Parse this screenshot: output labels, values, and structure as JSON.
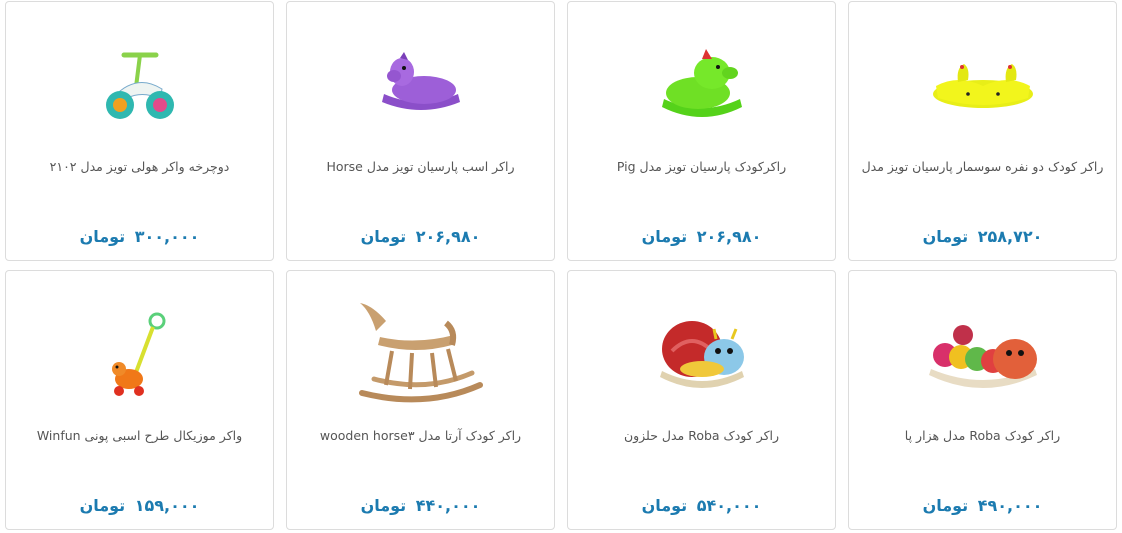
{
  "products": [
    {
      "title": "راکر کودک دو نفره سوسمار پارسیان تویز مدل",
      "price": "۲۵۸,۷۲۰",
      "currency": "تومان",
      "image": "double-yellow-rocker"
    },
    {
      "title": "راکرکودک پارسیان تویز مدل Pig",
      "price": "۲۰۶,۹۸۰",
      "currency": "تومان",
      "image": "green-pig-rocker"
    },
    {
      "title": "راکر اسب پارسیان تویز مدل Horse",
      "price": "۲۰۶,۹۸۰",
      "currency": "تومان",
      "image": "purple-horse-rocker"
    },
    {
      "title": "دوچرخه واکر هولی تویز مدل ۲۱۰۲",
      "price": "۳۰۰,۰۰۰",
      "currency": "تومان",
      "image": "balance-bike-walker"
    },
    {
      "title": "راکر کودک Roba مدل هزار پا",
      "price": "۴۹۰,۰۰۰",
      "currency": "تومان",
      "image": "caterpillar-rocker"
    },
    {
      "title": "راکر کودک Roba مدل حلزون",
      "price": "۵۴۰,۰۰۰",
      "currency": "تومان",
      "image": "snail-rocker"
    },
    {
      "title": "راکر کودک آرتا مدل wooden horse۳",
      "price": "۴۴۰,۰۰۰",
      "currency": "تومان",
      "image": "wooden-rocking-horse"
    },
    {
      "title": "واکر موزیکال طرح اسبی پونی Winfun",
      "price": "۱۵۹,۰۰۰",
      "currency": "تومان",
      "image": "pony-push-walker"
    }
  ]
}
